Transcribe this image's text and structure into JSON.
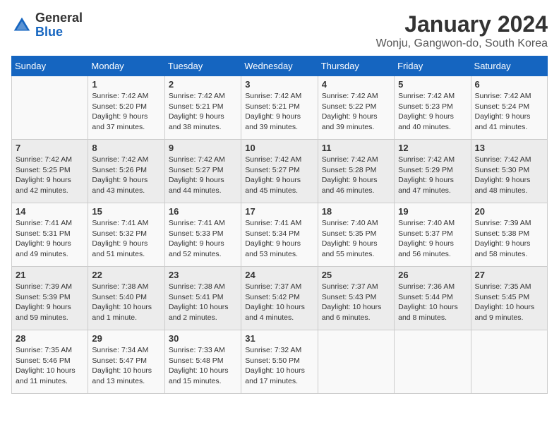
{
  "header": {
    "logo_general": "General",
    "logo_blue": "Blue",
    "main_title": "January 2024",
    "subtitle": "Wonju, Gangwon-do, South Korea"
  },
  "days_of_week": [
    "Sunday",
    "Monday",
    "Tuesday",
    "Wednesday",
    "Thursday",
    "Friday",
    "Saturday"
  ],
  "weeks": [
    [
      {
        "day": "",
        "info": ""
      },
      {
        "day": "1",
        "info": "Sunrise: 7:42 AM\nSunset: 5:20 PM\nDaylight: 9 hours\nand 37 minutes."
      },
      {
        "day": "2",
        "info": "Sunrise: 7:42 AM\nSunset: 5:21 PM\nDaylight: 9 hours\nand 38 minutes."
      },
      {
        "day": "3",
        "info": "Sunrise: 7:42 AM\nSunset: 5:21 PM\nDaylight: 9 hours\nand 39 minutes."
      },
      {
        "day": "4",
        "info": "Sunrise: 7:42 AM\nSunset: 5:22 PM\nDaylight: 9 hours\nand 39 minutes."
      },
      {
        "day": "5",
        "info": "Sunrise: 7:42 AM\nSunset: 5:23 PM\nDaylight: 9 hours\nand 40 minutes."
      },
      {
        "day": "6",
        "info": "Sunrise: 7:42 AM\nSunset: 5:24 PM\nDaylight: 9 hours\nand 41 minutes."
      }
    ],
    [
      {
        "day": "7",
        "info": "Sunrise: 7:42 AM\nSunset: 5:25 PM\nDaylight: 9 hours\nand 42 minutes."
      },
      {
        "day": "8",
        "info": "Sunrise: 7:42 AM\nSunset: 5:26 PM\nDaylight: 9 hours\nand 43 minutes."
      },
      {
        "day": "9",
        "info": "Sunrise: 7:42 AM\nSunset: 5:27 PM\nDaylight: 9 hours\nand 44 minutes."
      },
      {
        "day": "10",
        "info": "Sunrise: 7:42 AM\nSunset: 5:27 PM\nDaylight: 9 hours\nand 45 minutes."
      },
      {
        "day": "11",
        "info": "Sunrise: 7:42 AM\nSunset: 5:28 PM\nDaylight: 9 hours\nand 46 minutes."
      },
      {
        "day": "12",
        "info": "Sunrise: 7:42 AM\nSunset: 5:29 PM\nDaylight: 9 hours\nand 47 minutes."
      },
      {
        "day": "13",
        "info": "Sunrise: 7:42 AM\nSunset: 5:30 PM\nDaylight: 9 hours\nand 48 minutes."
      }
    ],
    [
      {
        "day": "14",
        "info": "Sunrise: 7:41 AM\nSunset: 5:31 PM\nDaylight: 9 hours\nand 49 minutes."
      },
      {
        "day": "15",
        "info": "Sunrise: 7:41 AM\nSunset: 5:32 PM\nDaylight: 9 hours\nand 51 minutes."
      },
      {
        "day": "16",
        "info": "Sunrise: 7:41 AM\nSunset: 5:33 PM\nDaylight: 9 hours\nand 52 minutes."
      },
      {
        "day": "17",
        "info": "Sunrise: 7:41 AM\nSunset: 5:34 PM\nDaylight: 9 hours\nand 53 minutes."
      },
      {
        "day": "18",
        "info": "Sunrise: 7:40 AM\nSunset: 5:35 PM\nDaylight: 9 hours\nand 55 minutes."
      },
      {
        "day": "19",
        "info": "Sunrise: 7:40 AM\nSunset: 5:37 PM\nDaylight: 9 hours\nand 56 minutes."
      },
      {
        "day": "20",
        "info": "Sunrise: 7:39 AM\nSunset: 5:38 PM\nDaylight: 9 hours\nand 58 minutes."
      }
    ],
    [
      {
        "day": "21",
        "info": "Sunrise: 7:39 AM\nSunset: 5:39 PM\nDaylight: 9 hours\nand 59 minutes."
      },
      {
        "day": "22",
        "info": "Sunrise: 7:38 AM\nSunset: 5:40 PM\nDaylight: 10 hours\nand 1 minute."
      },
      {
        "day": "23",
        "info": "Sunrise: 7:38 AM\nSunset: 5:41 PM\nDaylight: 10 hours\nand 2 minutes."
      },
      {
        "day": "24",
        "info": "Sunrise: 7:37 AM\nSunset: 5:42 PM\nDaylight: 10 hours\nand 4 minutes."
      },
      {
        "day": "25",
        "info": "Sunrise: 7:37 AM\nSunset: 5:43 PM\nDaylight: 10 hours\nand 6 minutes."
      },
      {
        "day": "26",
        "info": "Sunrise: 7:36 AM\nSunset: 5:44 PM\nDaylight: 10 hours\nand 8 minutes."
      },
      {
        "day": "27",
        "info": "Sunrise: 7:35 AM\nSunset: 5:45 PM\nDaylight: 10 hours\nand 9 minutes."
      }
    ],
    [
      {
        "day": "28",
        "info": "Sunrise: 7:35 AM\nSunset: 5:46 PM\nDaylight: 10 hours\nand 11 minutes."
      },
      {
        "day": "29",
        "info": "Sunrise: 7:34 AM\nSunset: 5:47 PM\nDaylight: 10 hours\nand 13 minutes."
      },
      {
        "day": "30",
        "info": "Sunrise: 7:33 AM\nSunset: 5:48 PM\nDaylight: 10 hours\nand 15 minutes."
      },
      {
        "day": "31",
        "info": "Sunrise: 7:32 AM\nSunset: 5:50 PM\nDaylight: 10 hours\nand 17 minutes."
      },
      {
        "day": "",
        "info": ""
      },
      {
        "day": "",
        "info": ""
      },
      {
        "day": "",
        "info": ""
      }
    ]
  ]
}
